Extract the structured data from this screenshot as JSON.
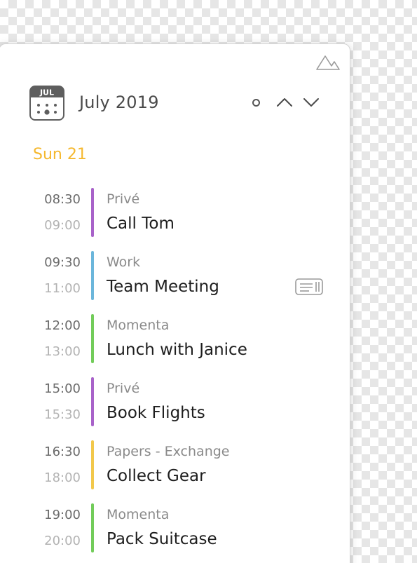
{
  "header": {
    "calendar_icon_text": "JUL",
    "month_title": "July 2019"
  },
  "day": {
    "label": "Sun 21",
    "color": "#f5b82e"
  },
  "calendar_colors": {
    "Privé": "#a862c9",
    "Work": "#6bb6db",
    "Momenta": "#72cc5a",
    "Papers - Exchange": "#f2c84b"
  },
  "events": [
    {
      "start": "08:30",
      "end": "09:00",
      "calendar": "Privé",
      "title": "Call Tom",
      "color": "#a862c9",
      "has_notes": false
    },
    {
      "start": "09:30",
      "end": "11:00",
      "calendar": "Work",
      "title": "Team Meeting",
      "color": "#6bb6db",
      "has_notes": true
    },
    {
      "start": "12:00",
      "end": "13:00",
      "calendar": "Momenta",
      "title": "Lunch with Janice",
      "color": "#72cc5a",
      "has_notes": false
    },
    {
      "start": "15:00",
      "end": "15:30",
      "calendar": "Privé",
      "title": "Book Flights",
      "color": "#a862c9",
      "has_notes": false
    },
    {
      "start": "16:30",
      "end": "18:00",
      "calendar": "Papers - Exchange",
      "title": "Collect Gear",
      "color": "#f2c84b",
      "has_notes": false
    },
    {
      "start": "19:00",
      "end": "20:00",
      "calendar": "Momenta",
      "title": "Pack Suitcase",
      "color": "#72cc5a",
      "has_notes": false
    }
  ],
  "icons": {
    "top_right": "mountain-icon",
    "header": "calendar-icon",
    "today": "today-dot-icon",
    "prev": "chevron-up-icon",
    "next": "chevron-down-icon",
    "notes": "notes-icon"
  }
}
